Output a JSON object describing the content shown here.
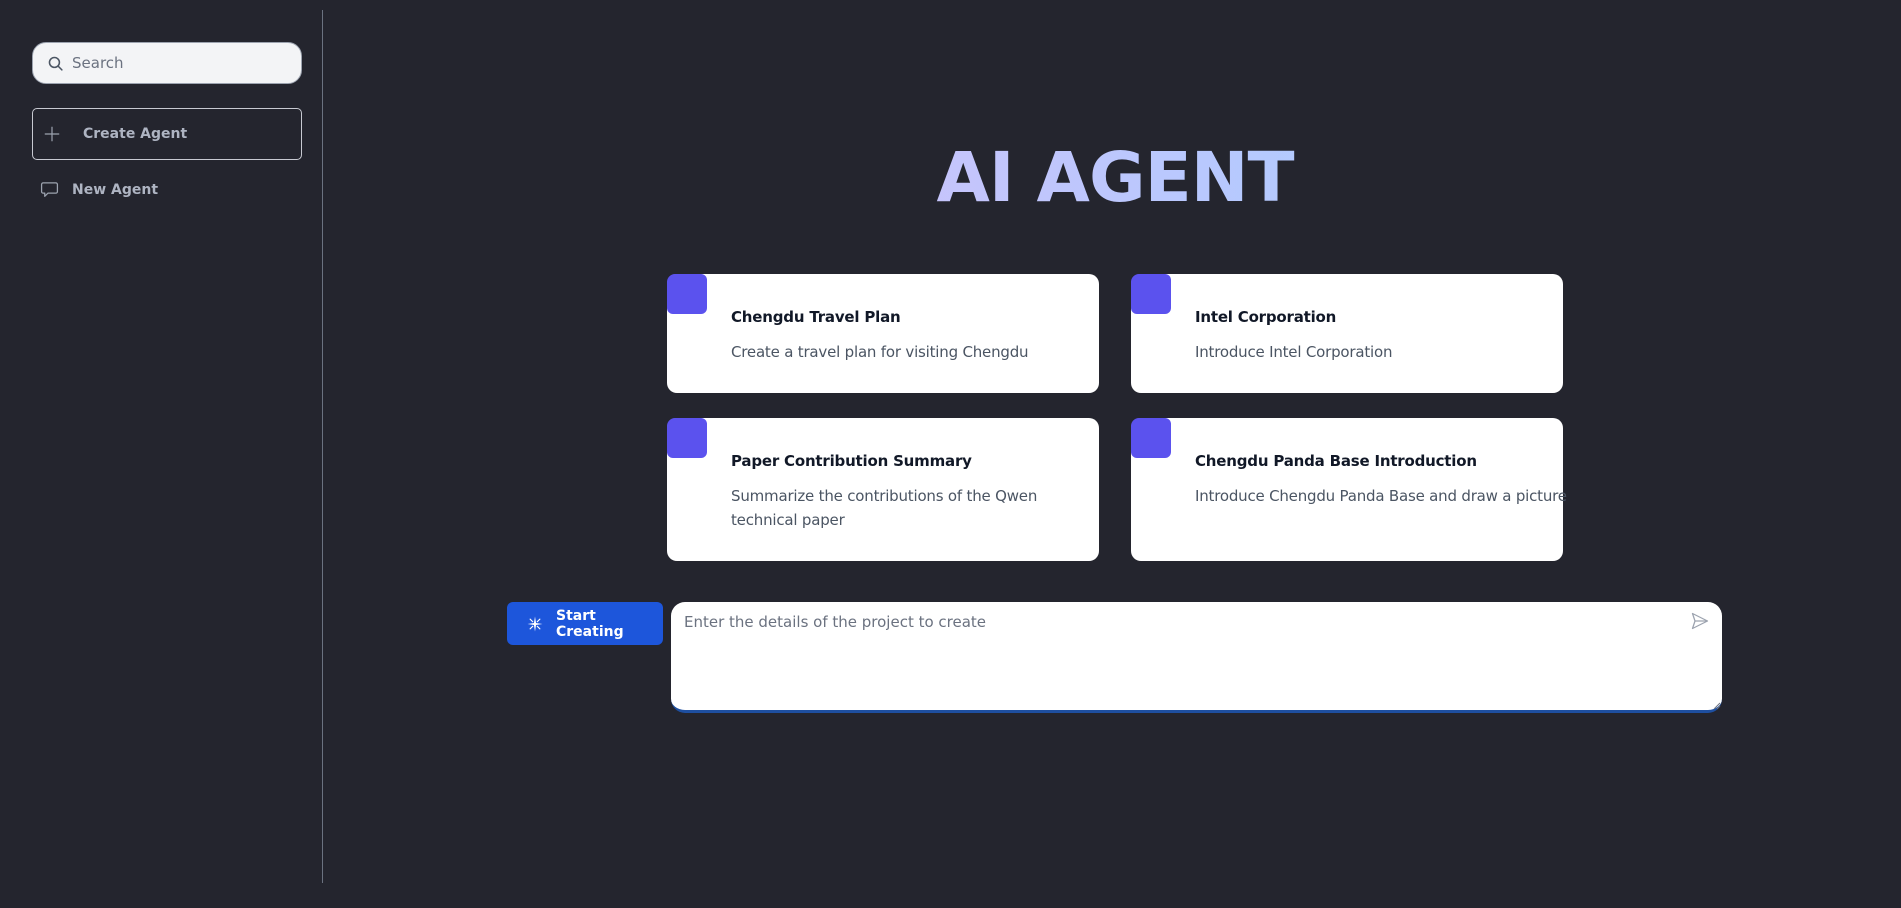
{
  "sidebar": {
    "search": {
      "placeholder": "Search",
      "value": "",
      "icon": "search-icon"
    },
    "create_agent": {
      "label": "Create Agent",
      "icon": "plus-icon"
    },
    "items": [
      {
        "label": "New Agent",
        "icon": "chat-bubble-icon"
      }
    ]
  },
  "main": {
    "title": "AI AGENT",
    "cards": [
      {
        "title": "Chengdu Travel Plan",
        "description": "Create a travel plan for visiting Chengdu"
      },
      {
        "title": "Intel Corporation",
        "description": "Introduce Intel Corporation"
      },
      {
        "title": "Paper Contribution Summary",
        "description": "Summarize the contributions of the Qwen technical paper"
      },
      {
        "title": "Chengdu Panda Base Introduction",
        "description": "Introduce Chengdu Panda Base and draw a picture"
      }
    ],
    "start_button": {
      "label": "Start Creating",
      "icon": "sparkle-icon"
    },
    "prompt": {
      "placeholder": "Enter the details of the project to create",
      "value": "",
      "send_icon": "send-icon"
    }
  },
  "colors": {
    "background": "#24252e",
    "accent": "#1d56db",
    "card_badge": "#5b52ee",
    "title_gradient_start": "#c7c4fb",
    "title_gradient_end": "#b2caff"
  }
}
